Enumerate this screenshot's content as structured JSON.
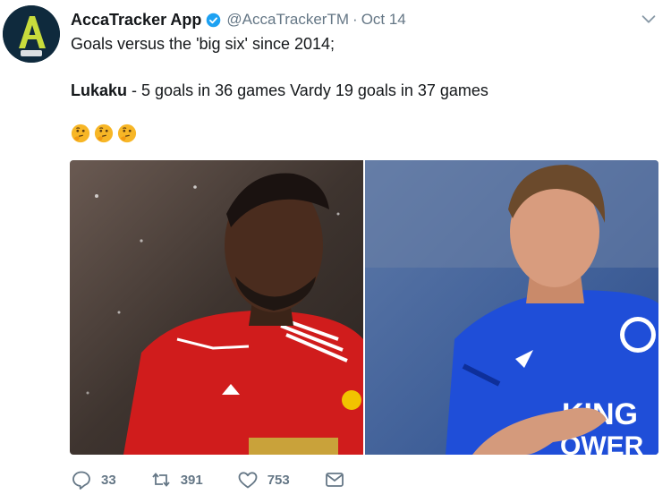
{
  "tweet": {
    "display_name": "AccaTracker App",
    "handle": "@AccaTrackerTM",
    "separator": "·",
    "date": "Oct 14",
    "line1": "Goals versus the 'big six' since 2014;",
    "line2_bold": "Lukaku",
    "line2_rest": " - 5 goals in 36 games Vardy 19 goals in 37 games",
    "emojis": [
      "thinking-face",
      "thinking-face",
      "thinking-face"
    ],
    "avatar_letter": "A",
    "media": [
      {
        "subject": "player in red Manchester United kit"
      },
      {
        "subject": "player in blue Leicester City kit"
      }
    ],
    "actions": {
      "replies": "33",
      "retweets": "391",
      "likes": "753"
    },
    "colors": {
      "text": "#14171a",
      "muted": "#657786",
      "verified": "#1da1f2",
      "avatar_bg": "#0f2a3d",
      "avatar_accent": "#c8dc3c"
    }
  }
}
